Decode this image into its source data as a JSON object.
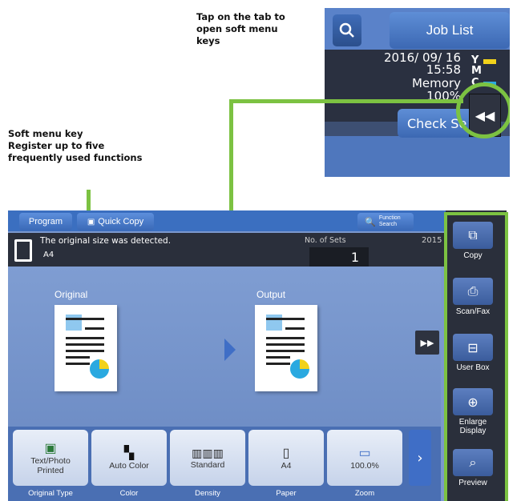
{
  "captions": {
    "tab": [
      "Tap on the tab to",
      "open soft menu",
      "keys"
    ],
    "soft_menu": [
      "Soft menu key",
      "Register up to five",
      "frequently used functions"
    ]
  },
  "inset": {
    "job_list": "Job List",
    "date": "2016/ 09/ 16",
    "time": "15:58",
    "memory_label": "Memory",
    "memory_value": "100%",
    "toner_y": "Y",
    "toner_m": "M",
    "toner_c": "C",
    "check_button": "Check Se"
  },
  "main": {
    "program": "Program",
    "quick_copy": "Quick Copy",
    "function_search": "Function Search",
    "status_message": "The original size was detected.",
    "paper_size": "A4",
    "sets_label": "No. of Sets",
    "sets_value": "1",
    "year_partial": "2015",
    "original_label": "Original",
    "output_label": "Output",
    "function_keys": [
      {
        "label": "Text/Photo Printed",
        "caption": "Original Type"
      },
      {
        "label": "Auto Color",
        "caption": "Color"
      },
      {
        "label": "Standard",
        "caption": "Density"
      },
      {
        "label": "A4",
        "caption": "Paper"
      },
      {
        "label": "100.0%",
        "caption": "Zoom"
      }
    ]
  },
  "soft_menu": [
    {
      "label": "Copy",
      "icon": "copy-icon"
    },
    {
      "label": "Scan/Fax",
      "icon": "scan-fax-icon"
    },
    {
      "label": "User Box",
      "icon": "user-box-icon"
    },
    {
      "label": "Enlarge Display",
      "icon": "enlarge-display-icon"
    },
    {
      "label": "Preview",
      "icon": "preview-icon"
    }
  ],
  "colors": {
    "highlight_green": "#7cc242",
    "panel_blue": "#7b98cd",
    "button_blue": "#3f6ec6",
    "dark_bar": "#2a2f3b"
  }
}
